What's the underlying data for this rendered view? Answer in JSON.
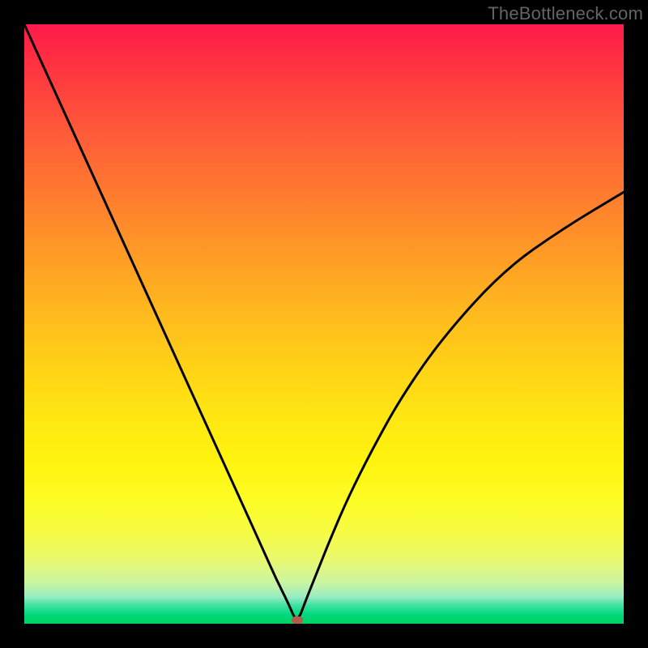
{
  "watermark": "TheBottleneck.com",
  "marker_color": "#b95a4a",
  "chart_data": {
    "type": "line",
    "title": "",
    "xlabel": "",
    "ylabel": "",
    "xlim": [
      0,
      1
    ],
    "ylim": [
      0,
      1
    ],
    "grid": false,
    "notes": "V-shaped curve on a vertical green→red gradient; minimum (0) at x≈0.455; marker at the minimum.",
    "series": [
      {
        "name": "curve",
        "x": [
          0.0,
          0.05,
          0.1,
          0.15,
          0.2,
          0.25,
          0.3,
          0.35,
          0.4,
          0.42,
          0.44,
          0.455,
          0.47,
          0.49,
          0.51,
          0.54,
          0.58,
          0.63,
          0.7,
          0.8,
          0.9,
          1.0
        ],
        "y": [
          1.0,
          0.89,
          0.78,
          0.67,
          0.56,
          0.45,
          0.34,
          0.23,
          0.12,
          0.075,
          0.035,
          0.0,
          0.04,
          0.09,
          0.14,
          0.21,
          0.29,
          0.38,
          0.48,
          0.59,
          0.66,
          0.72
        ]
      }
    ],
    "marker": {
      "x": 0.455,
      "y": 0.0
    }
  }
}
